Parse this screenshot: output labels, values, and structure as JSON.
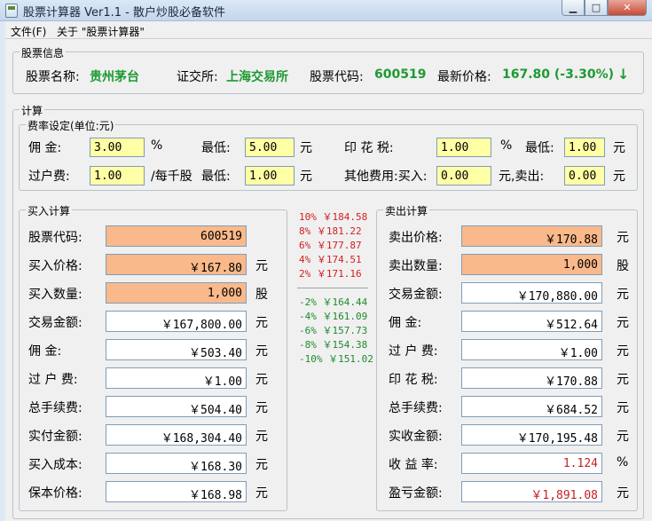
{
  "window": {
    "title": "股票计算器 Ver1.1 - 散户炒股必备软件",
    "buttons": {
      "minimize": "▁",
      "maximize": "□",
      "close": "✕"
    }
  },
  "menu": {
    "file": "文件(F)",
    "about": "关于 \"股票计算器\""
  },
  "stock_info": {
    "legend": "股票信息",
    "name_label": "股票名称:",
    "name": "贵州茅台",
    "exchange_label": "证交所:",
    "exchange": "上海交易所",
    "code_label": "股票代码:",
    "code": "600519",
    "price_label": "最新价格:",
    "price": "167.80 (-3.30%)",
    "trend_arrow": "↓"
  },
  "calc": {
    "legend": "计算",
    "fees": {
      "legend": "费率设定(单位:元)",
      "commission_label": "佣  金:",
      "commission": "3.00",
      "percent_unit": "%",
      "min_label": "最低:",
      "commission_min": "5.00",
      "yuan_unit": "元",
      "stamp_label": "印 花 税:",
      "stamp": "1.00",
      "stamp_unit": "%",
      "stamp_min_label": "最低:",
      "stamp_min": "1.00",
      "stamp_min_unit": "元",
      "transfer_label": "过户费:",
      "transfer": "1.00",
      "per_thousand": "/每千股",
      "transfer_min_label": "最低:",
      "transfer_min": "1.00",
      "transfer_min_unit": "元",
      "other_label": "其他费用:买入:",
      "other_buy": "0.00",
      "sell_label": "元,卖出:",
      "other_sell": "0.00",
      "other_unit": "元"
    },
    "buy": {
      "legend": "买入计算",
      "rows": [
        {
          "label": "股票代码:",
          "value": "600519",
          "unit": ""
        },
        {
          "label": "买入价格:",
          "value": "￥167.80",
          "unit": "元"
        },
        {
          "label": "买入数量:",
          "value": "1,000",
          "unit": "股"
        },
        {
          "label": "交易金额:",
          "value": "￥167,800.00",
          "unit": "元"
        },
        {
          "label": "佣    金:",
          "value": "￥503.40",
          "unit": "元"
        },
        {
          "label": "过 户 费:",
          "value": "￥1.00",
          "unit": "元"
        },
        {
          "label": "总手续费:",
          "value": "￥504.40",
          "unit": "元"
        },
        {
          "label": "实付金额:",
          "value": "￥168,304.40",
          "unit": "元"
        },
        {
          "label": "买入成本:",
          "value": "￥168.30",
          "unit": "元"
        },
        {
          "label": "保本价格:",
          "value": "￥168.98",
          "unit": "元"
        }
      ]
    },
    "targets_up": [
      "10% ￥184.58",
      "8%  ￥181.22",
      "6%  ￥177.87",
      "4%  ￥174.51",
      "2%  ￥171.16"
    ],
    "targets_down": [
      "-2%  ￥164.44",
      "-4%  ￥161.09",
      "-6%  ￥157.73",
      "-8%  ￥154.38",
      "-10% ￥151.02"
    ],
    "sell": {
      "legend": "卖出计算",
      "rows": [
        {
          "label": "卖出价格:",
          "value": "￥170.88",
          "unit": "元"
        },
        {
          "label": "卖出数量:",
          "value": "1,000",
          "unit": "股"
        },
        {
          "label": "交易金额:",
          "value": "￥170,880.00",
          "unit": "元"
        },
        {
          "label": "佣    金:",
          "value": "￥512.64",
          "unit": "元"
        },
        {
          "label": "过 户 费:",
          "value": "￥1.00",
          "unit": "元"
        },
        {
          "label": "印 花 税:",
          "value": "￥170.88",
          "unit": "元"
        },
        {
          "label": "总手续费:",
          "value": "￥684.52",
          "unit": "元"
        },
        {
          "label": "实收金额:",
          "value": "￥170,195.48",
          "unit": "元"
        },
        {
          "label": "收 益 率:",
          "value": "1.124",
          "unit": "%"
        },
        {
          "label": "盈亏金额:",
          "value": "￥1,891.08",
          "unit": "元"
        }
      ]
    }
  },
  "colors": {
    "price_green": "#1e9a33",
    "orange_input": "#fab98a",
    "yellow_input": "#ffffa5",
    "gain_red": "#c32026"
  }
}
